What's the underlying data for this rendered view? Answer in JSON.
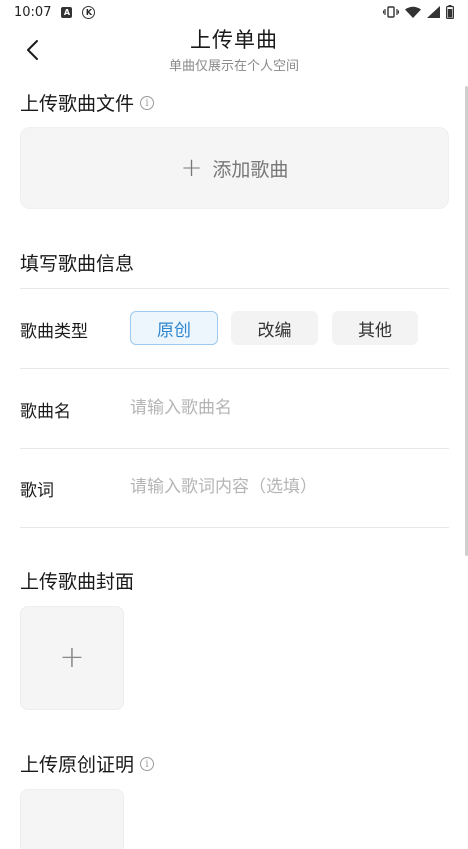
{
  "status": {
    "time": "10:07",
    "left_icons": [
      "A",
      "K"
    ],
    "right_icons": [
      "vibrate-icon",
      "wifi-icon",
      "signal-icon",
      "battery-icon"
    ]
  },
  "header": {
    "title": "上传单曲",
    "subtitle": "单曲仅展示在个人空间"
  },
  "sections": {
    "upload_file": {
      "title": "上传歌曲文件",
      "add_label": "添加歌曲"
    },
    "info": {
      "title": "填写歌曲信息"
    },
    "cover": {
      "title": "上传歌曲封面"
    },
    "proof": {
      "title": "上传原创证明"
    }
  },
  "form": {
    "type_label": "歌曲类型",
    "types": [
      {
        "label": "原创",
        "selected": true
      },
      {
        "label": "改编",
        "selected": false
      },
      {
        "label": "其他",
        "selected": false
      }
    ],
    "name_label": "歌曲名",
    "name_placeholder": "请输入歌曲名",
    "name_value": "",
    "lyrics_label": "歌词",
    "lyrics_placeholder": "请输入歌词内容（选填）",
    "lyrics_value": ""
  },
  "colors": {
    "accent": "#2d86d0",
    "chip_selected_bg": "#eef6fd",
    "muted": "#8a8a8a"
  }
}
